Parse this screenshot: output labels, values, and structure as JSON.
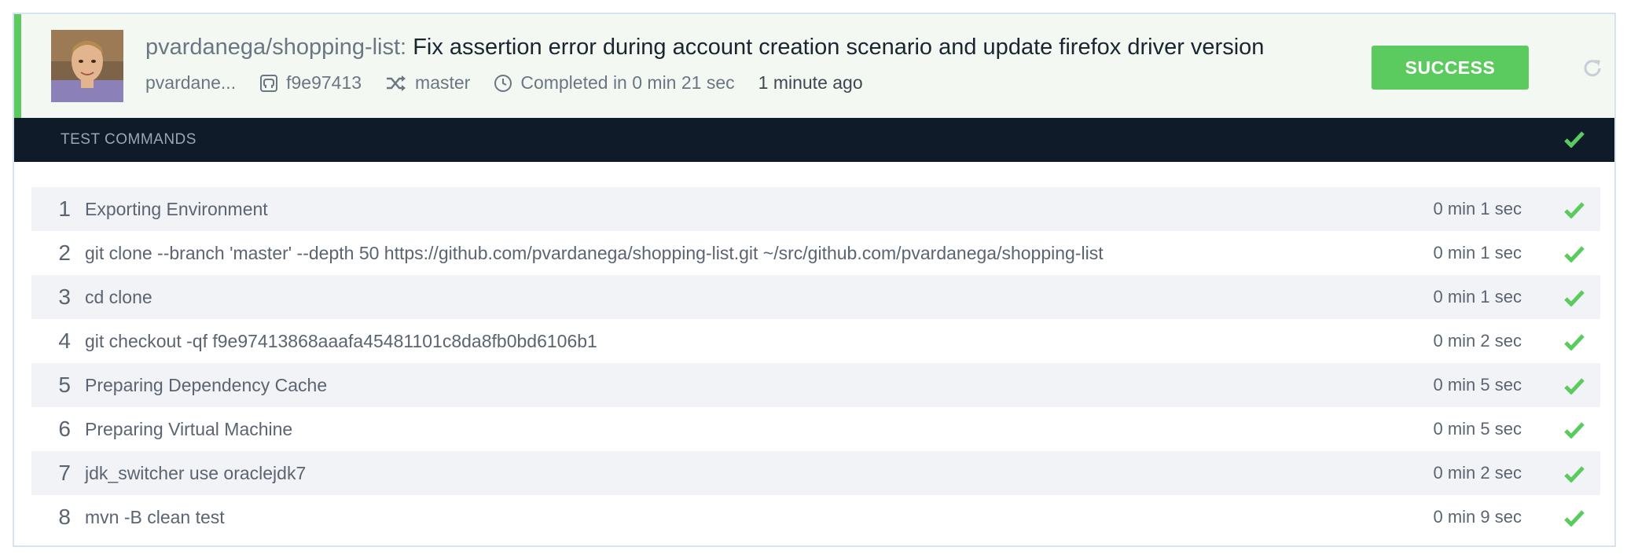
{
  "header": {
    "repo": "pvardanega/shopping-list:",
    "commit_message": "Fix assertion error during account creation scenario and update firefox driver version",
    "author": "pvardane...",
    "commit_sha": "f9e97413",
    "branch": "master",
    "completed": "Completed in 0 min 21 sec",
    "time_ago": "1 minute ago",
    "status": "SUCCESS",
    "status_color": "#5ccb5f"
  },
  "section": {
    "title": "TEST COMMANDS"
  },
  "commands": [
    {
      "num": "1",
      "text": "Exporting Environment",
      "duration": "0 min 1 sec"
    },
    {
      "num": "2",
      "text": "git clone --branch 'master' --depth 50 https://github.com/pvardanega/shopping-list.git ~/src/github.com/pvardanega/shopping-list",
      "duration": "0 min 1 sec"
    },
    {
      "num": "3",
      "text": "cd clone",
      "duration": "0 min 1 sec"
    },
    {
      "num": "4",
      "text": "git checkout -qf f9e97413868aaafa45481101c8da8fb0bd6106b1",
      "duration": "0 min 2 sec"
    },
    {
      "num": "5",
      "text": "Preparing Dependency Cache",
      "duration": "0 min 5 sec"
    },
    {
      "num": "6",
      "text": "Preparing Virtual Machine",
      "duration": "0 min 5 sec"
    },
    {
      "num": "7",
      "text": "jdk_switcher use oraclejdk7",
      "duration": "0 min 2 sec"
    },
    {
      "num": "8",
      "text": "mvn -B clean test",
      "duration": "0 min 9 sec"
    }
  ]
}
